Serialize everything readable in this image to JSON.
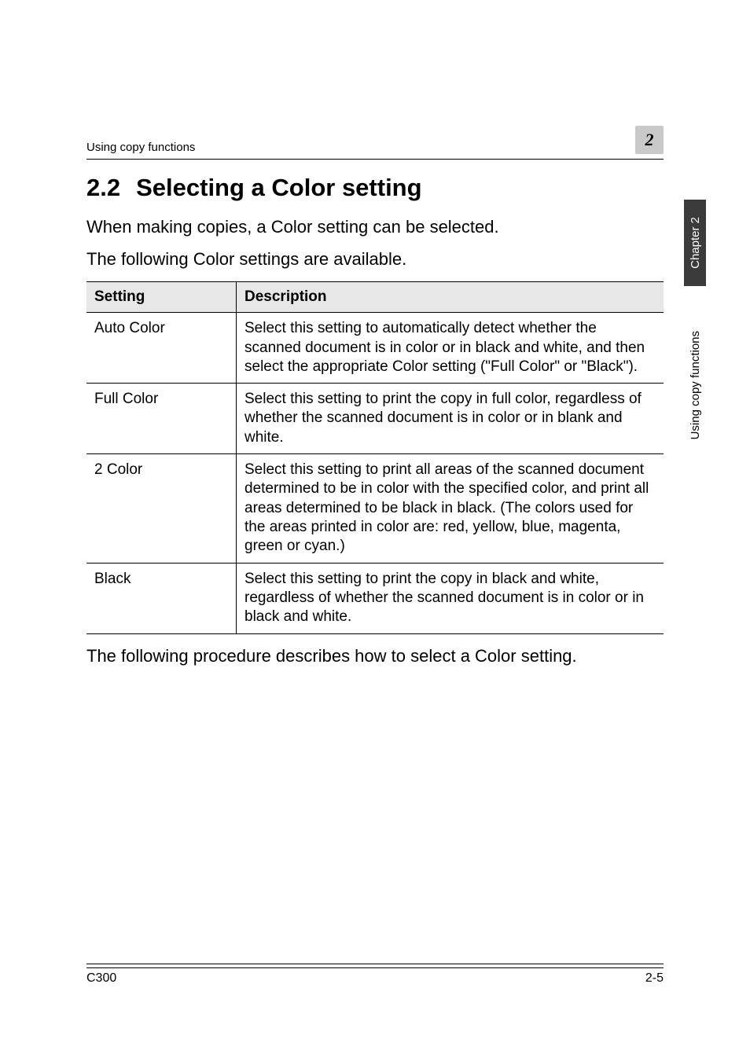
{
  "running_head": {
    "left": "Using copy functions",
    "chapter_box": "2"
  },
  "section": {
    "number": "2.2",
    "title": "Selecting a Color setting"
  },
  "intro": {
    "p1": "When making copies, a Color setting can be selected.",
    "p2": "The following Color settings are available."
  },
  "table": {
    "headers": {
      "setting": "Setting",
      "description": "Description"
    },
    "rows": [
      {
        "setting": "Auto Color",
        "description": "Select this setting to automatically detect whether the scanned document is in color or in black and white, and then select the appropriate Color setting (\"Full Color\" or \"Black\")."
      },
      {
        "setting": "Full Color",
        "description": "Select this setting to print the copy in full color, regardless of whether the scanned document is in color or in blank and white."
      },
      {
        "setting": "2 Color",
        "description": "Select this setting to print all areas of the scanned document determined to be in color with the specified color, and print all areas determined to be black in black. (The colors used for the areas printed in color are: red, yellow, blue, magenta, green or cyan.)"
      },
      {
        "setting": "Black",
        "description": "Select this setting to print the copy in black and white, regardless of whether the scanned document is in color or in black and white."
      }
    ]
  },
  "after_table": "The following procedure describes how to select a Color setting.",
  "side_tabs": {
    "dark": "Chapter 2",
    "light": "Using copy functions"
  },
  "footer": {
    "left": "C300",
    "right": "2-5"
  }
}
